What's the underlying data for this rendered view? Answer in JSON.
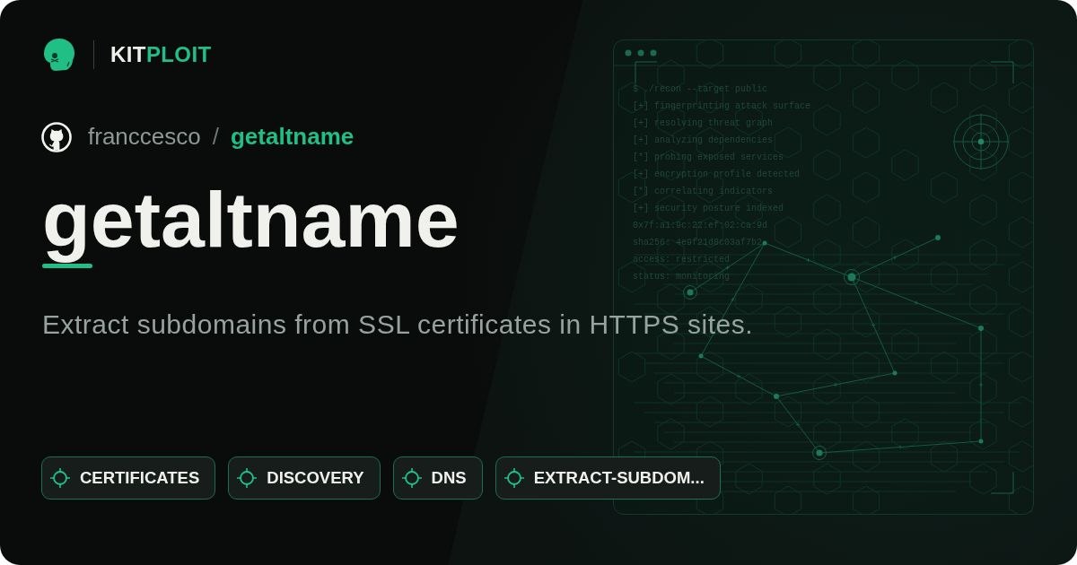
{
  "brand": {
    "name_plain": "KIT",
    "name_accent": "PLOIT"
  },
  "repository": {
    "owner": "franccesco",
    "separator": "/",
    "name": "getaltname"
  },
  "title": "getaltname",
  "description": "Extract subdomains from SSL certificates in HTTPS sites.",
  "tags": [
    "CERTIFICATES",
    "DISCOVERY",
    "DNS",
    "EXTRACT-SUBDOM..."
  ],
  "terminal": {
    "lines": [
      "$ ./recon --target public",
      "[+] fingerprinting attack surface",
      "[+] resolving threat graph",
      "[+] analyzing dependencies",
      "[*] probing exposed services",
      "[+] encryption profile detected",
      "[*] correlating indicators",
      "[+] security posture indexed",
      "0x7f:a1:9c:22:ef:02:ca:9d",
      "sha256: 4e9f21d8c03af7b2",
      "access: restricted",
      "status: monitoring"
    ]
  }
}
